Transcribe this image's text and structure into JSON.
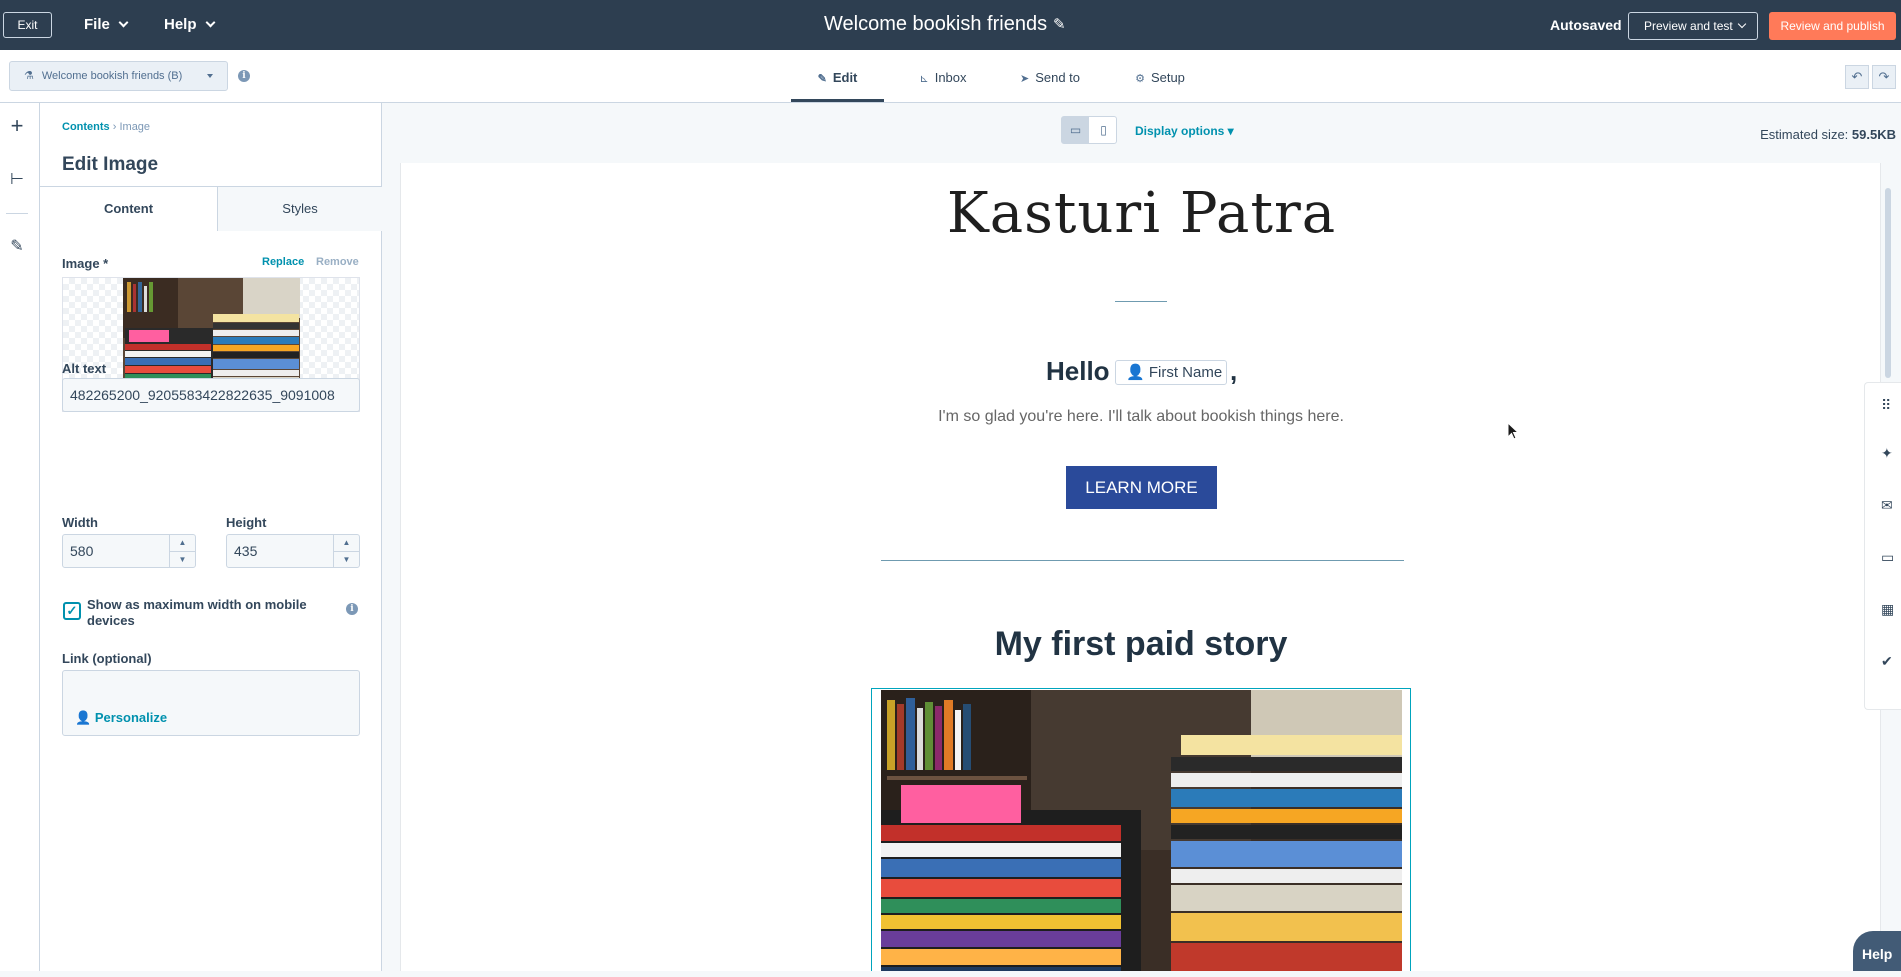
{
  "topbar": {
    "exit_label": "Exit",
    "file_label": "File",
    "help_label": "Help",
    "doc_title": "Welcome bookish friends",
    "autosaved": "Autosaved",
    "preview_label": "Preview and test",
    "publish_label": "Review and publish",
    "publish_color": "#ff7a59",
    "bar_color": "#2d3e50"
  },
  "subbar": {
    "version_label": "Welcome bookish friends (B)",
    "tabs": [
      {
        "label": "Edit",
        "icon": "pencil-icon"
      },
      {
        "label": "Inbox",
        "icon": "inbox-icon"
      },
      {
        "label": "Send to",
        "icon": "send-icon"
      },
      {
        "label": "Setup",
        "icon": "gear-icon"
      }
    ]
  },
  "panel": {
    "breadcrumb_link": "Contents",
    "breadcrumb_current": "Image",
    "title": "Edit Image",
    "tabs": [
      "Content",
      "Styles"
    ],
    "image_label": "Image *",
    "replace_label": "Replace",
    "remove_label": "Remove",
    "alt_label": "Alt text",
    "alt_value": "482265200_9205583422822635_9091008",
    "width_label": "Width",
    "width_value": "580",
    "height_label": "Height",
    "height_value": "435",
    "mobile_label": "Show as maximum width on mobile devices",
    "link_label": "Link (optional)",
    "personalize_label": "Personalize"
  },
  "canvas": {
    "display_options": "Display options",
    "estimated_label": "Estimated size:",
    "estimated_value": "59.5KB",
    "brand": "Kasturi Patra",
    "hello": "Hello",
    "token": "First Name",
    "comma": ",",
    "intro": "I'm so glad you're here. I'll talk about bookish things here.",
    "cta": "LEARN MORE",
    "cta_color": "#2a4a9a",
    "story_title": "My first paid story"
  },
  "help_button": "Help"
}
